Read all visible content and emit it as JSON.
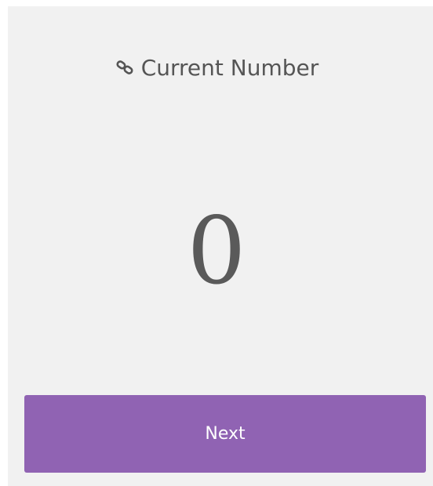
{
  "header": {
    "icon": "link-icon",
    "title": "Current Number"
  },
  "display": {
    "value": "0"
  },
  "actions": {
    "next_label": "Next"
  },
  "colors": {
    "background": "#f1f1f1",
    "button": "#9063b3",
    "button_text": "#ffffff",
    "text": "#555555"
  }
}
